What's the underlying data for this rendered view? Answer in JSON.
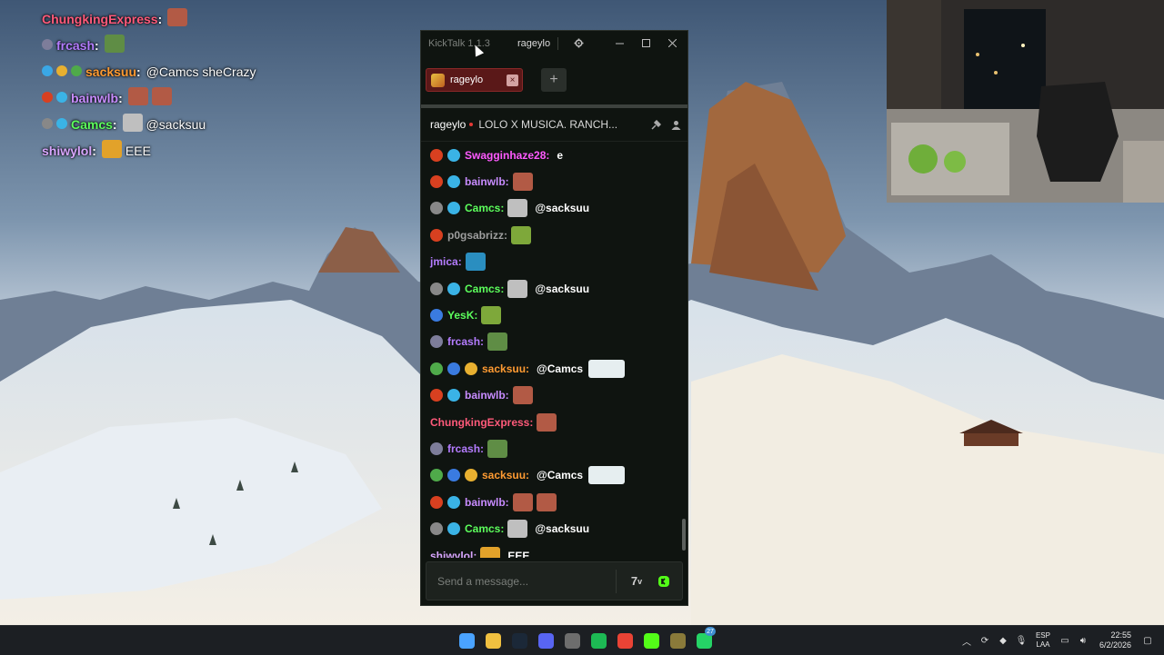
{
  "overlay_chat": [
    {
      "user": "ChungkingExpress",
      "color": "#ff5a7a",
      "badges": [],
      "emotes": [
        "#b25a45"
      ],
      "message": ""
    },
    {
      "user": "frcash",
      "color": "#b47cff",
      "badges": [
        "#7d7d9a"
      ],
      "emotes": [
        "#5f8d45"
      ],
      "message": ""
    },
    {
      "user": "sacksuu",
      "color": "#ff9b32",
      "badges": [
        "#3aa7e6",
        "#e8b030",
        "#4faa4a"
      ],
      "emotes": [],
      "message": "@Camcs sheCrazy"
    },
    {
      "user": "bainwlb",
      "color": "#c88cff",
      "badges": [
        "#d84020",
        "#3ab3e6"
      ],
      "emotes": [
        "#b25a45",
        "#b25a45"
      ],
      "message": ""
    },
    {
      "user": "Camcs",
      "color": "#5cff5c",
      "badges": [
        "#888888",
        "#3ab3e6"
      ],
      "emotes": [
        "#bfbfbf"
      ],
      "message": "@sacksuu"
    },
    {
      "user": "shiwylol",
      "color": "#d9a6ff",
      "badges": [],
      "emotes": [
        "#e2a22a"
      ],
      "message": "EEE"
    }
  ],
  "window": {
    "app_title": "KickTalk 1.1.3",
    "username": "rageylo",
    "settings_icon": "gear-icon",
    "minimize_icon": "minimize-icon",
    "maximize_icon": "maximize-icon",
    "close_icon": "close-icon"
  },
  "tabs": [
    {
      "label": "rageylo",
      "close": "×"
    }
  ],
  "add_tab_label": "+",
  "channel": {
    "name": "rageylo",
    "stream_title": "LOLO X MUSICA. RANCH...",
    "live_color": "#e53935"
  },
  "messages": [
    {
      "user": "Swagginhaze28",
      "color": "#ff5aff",
      "badges": [
        "#d84020",
        "#3ab3e6"
      ],
      "emotes": [],
      "message": "e"
    },
    {
      "user": "bainwlb",
      "color": "#c88cff",
      "badges": [
        "#d84020",
        "#3ab3e6"
      ],
      "emotes": [
        "#b25a45"
      ],
      "message": ""
    },
    {
      "user": "Camcs",
      "color": "#5cff5c",
      "badges": [
        "#888888",
        "#3ab3e6"
      ],
      "emotes": [
        "#bfbfbf"
      ],
      "message": "@sacksuu"
    },
    {
      "user": "p0gsabrizz",
      "color": "#9e9e9e",
      "badges": [
        "#d84020"
      ],
      "emotes": [
        "#7ea83a"
      ],
      "message": ""
    },
    {
      "user": "jmica",
      "color": "#b47cff",
      "badges": [],
      "emotes": [
        "#2a8ec0"
      ],
      "message": ""
    },
    {
      "user": "Camcs",
      "color": "#5cff5c",
      "badges": [
        "#888888",
        "#3ab3e6"
      ],
      "emotes": [
        "#bfbfbf"
      ],
      "message": "@sacksuu"
    },
    {
      "user": "YesK",
      "color": "#5cff5c",
      "badges": [
        "#3a7be0"
      ],
      "emotes": [
        "#7ea83a"
      ],
      "message": ""
    },
    {
      "user": "frcash",
      "color": "#b47cff",
      "badges": [
        "#7d7d9a"
      ],
      "emotes": [
        "#5f8d45"
      ],
      "message": ""
    },
    {
      "user": "sacksuu",
      "color": "#ff9b32",
      "badges": [
        "#4faa4a",
        "#3a7be0",
        "#e8b030"
      ],
      "emotes": [],
      "message": "@Camcs"
    },
    {
      "user": "bainwlb",
      "color": "#c88cff",
      "badges": [
        "#d84020",
        "#3ab3e6"
      ],
      "emotes": [
        "#b25a45"
      ],
      "message": ""
    },
    {
      "user": "ChungkingExpress",
      "color": "#ff5a7a",
      "badges": [],
      "emotes": [
        "#b25a45"
      ],
      "message": ""
    },
    {
      "user": "frcash",
      "color": "#b47cff",
      "badges": [
        "#7d7d9a"
      ],
      "emotes": [
        "#5f8d45"
      ],
      "message": ""
    },
    {
      "user": "sacksuu",
      "color": "#ff9b32",
      "badges": [
        "#4faa4a",
        "#3a7be0",
        "#e8b030"
      ],
      "emotes": [],
      "message": "@Camcs"
    },
    {
      "user": "bainwlb",
      "color": "#c88cff",
      "badges": [
        "#d84020",
        "#3ab3e6"
      ],
      "emotes": [
        "#b25a45",
        "#b25a45"
      ],
      "message": ""
    },
    {
      "user": "Camcs",
      "color": "#5cff5c",
      "badges": [
        "#888888",
        "#3ab3e6"
      ],
      "emotes": [
        "#bfbfbf"
      ],
      "message": "@sacksuu"
    },
    {
      "user": "shiwylol",
      "color": "#d9a6ff",
      "badges": [],
      "emotes": [
        "#e2a22a"
      ],
      "message": "EEE"
    }
  ],
  "input": {
    "placeholder": "Send a message...",
    "kick_emote_icon": "7tv-icon",
    "emote_picker_icon": "kick-emote-icon"
  },
  "taskbar": {
    "apps": [
      {
        "name": "windows-start-icon",
        "color": "#4aa3ff"
      },
      {
        "name": "file-explorer-icon",
        "color": "#f0c040"
      },
      {
        "name": "steam-icon",
        "color": "#1b2838"
      },
      {
        "name": "discord-icon",
        "color": "#5865f2"
      },
      {
        "name": "obs-icon",
        "color": "#6d6d6d"
      },
      {
        "name": "spotify-icon",
        "color": "#1db954"
      },
      {
        "name": "chrome-icon",
        "color": "#ea4335"
      },
      {
        "name": "kicktalk-icon",
        "color": "#53fc18"
      },
      {
        "name": "minecraft-icon",
        "color": "#8a7a3a"
      },
      {
        "name": "whatsapp-icon",
        "color": "#25d366",
        "badge": "27"
      }
    ],
    "lang_top": "ESP",
    "lang_bottom": "LAA",
    "time": "22:55",
    "date": "6/2/2026"
  }
}
